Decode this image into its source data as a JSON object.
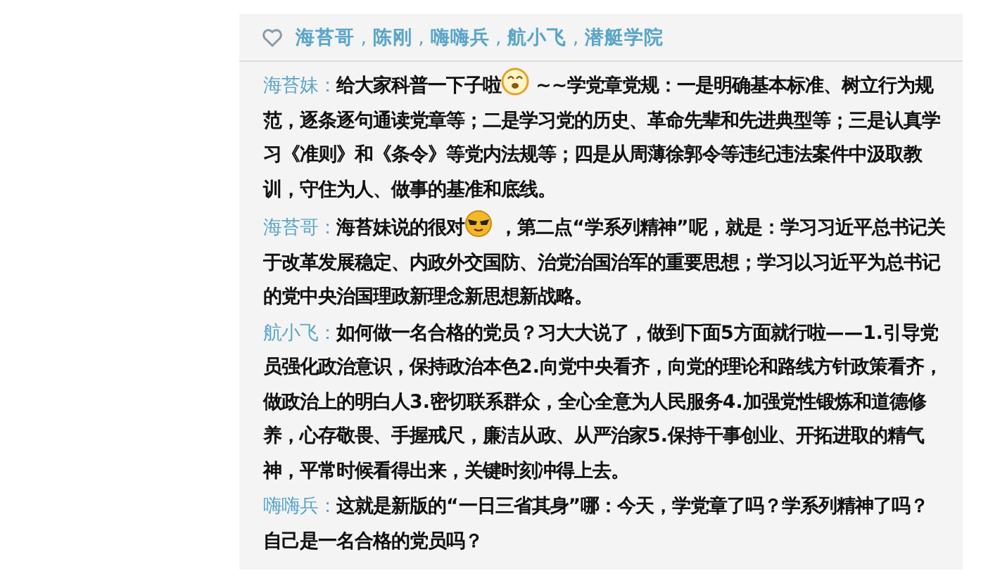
{
  "likes": {
    "separator": " , ",
    "names": [
      "海苔哥",
      "陈刚",
      "嗨嗨兵",
      "航小飞",
      "潜艇学院"
    ]
  },
  "comments": [
    {
      "author": "海苔妹：",
      "parts": [
        {
          "kind": "text",
          "text": "给大家科普一下子啦"
        },
        {
          "kind": "grin"
        },
        {
          "kind": "text",
          "text": " ~~学党章党规：一是明确基本标准、树立行为规范，逐条逐句通读党章等；二是学习党的历史、革命先辈和先进典型等；三是认真学习《准则》和《条令》等党内法规等；四是从周薄徐郭令等违纪违法案件中汲取教训，守住为人、做事的基准和底线。"
        }
      ]
    },
    {
      "author": "海苔哥：",
      "parts": [
        {
          "kind": "text",
          "text": "海苔妹说的很对"
        },
        {
          "kind": "cool"
        },
        {
          "kind": "text",
          "text": " ，第二点“学系列精神”呢，就是：学习习近平总书记关于改革发展稳定、内政外交国防、治党治国治军的重要思想；学习以习近平为总书记的党中央治国理政新理念新思想新战略。"
        }
      ]
    },
    {
      "author": "航小飞：",
      "parts": [
        {
          "kind": "text",
          "text": "如何做一名合格的党员？习大大说了，做到下面5方面就行啦——1.引导党员强化政治意识，保持政治本色2.向党中央看齐，向党的理论和路线方针政策看齐，做政治上的明白人3.密切联系群众，全心全意为人民服务4.加强党性锻炼和道德修养，心存敬畏、手握戒尺，廉洁从政、从严治家5.保持干事创业、开拓进取的精气神，平常时候看得出来，关键时刻冲得上去。"
        }
      ]
    },
    {
      "author": "嗨嗨兵：",
      "parts": [
        {
          "kind": "text",
          "text": "这就是新版的“一日三省其身”哪：今天，学党章了吗？学系列精神了吗？自己是一名合格的党员吗？"
        }
      ]
    }
  ]
}
